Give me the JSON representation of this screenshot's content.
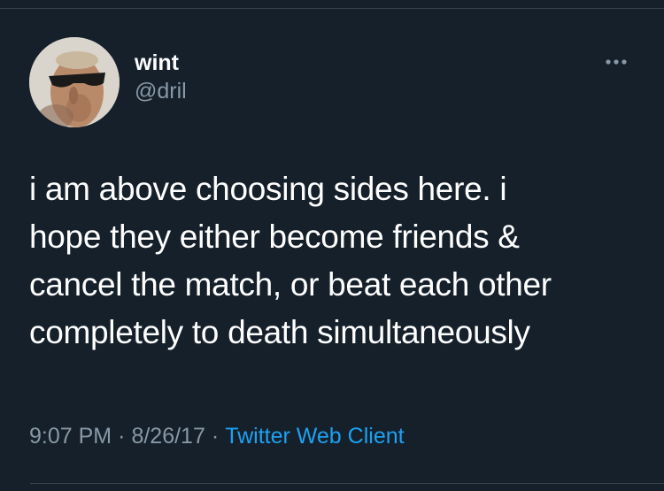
{
  "tweet": {
    "display_name": "wint",
    "handle": "@dril",
    "text": "i am above choosing sides here. i\nhope they either become friends &\ncancel the match, or beat each other\ncompletely to death simultaneously",
    "time": "9:07 PM",
    "date": "8/26/17",
    "separator": "·",
    "client": "Twitter Web Client"
  },
  "icons": {
    "more": "more-horizontal-icon",
    "avatar": "profile-avatar"
  },
  "colors": {
    "background": "#15202b",
    "text": "#ffffff",
    "secondary": "#8899a6",
    "link": "#1da1f2",
    "divider": "#38444d"
  }
}
